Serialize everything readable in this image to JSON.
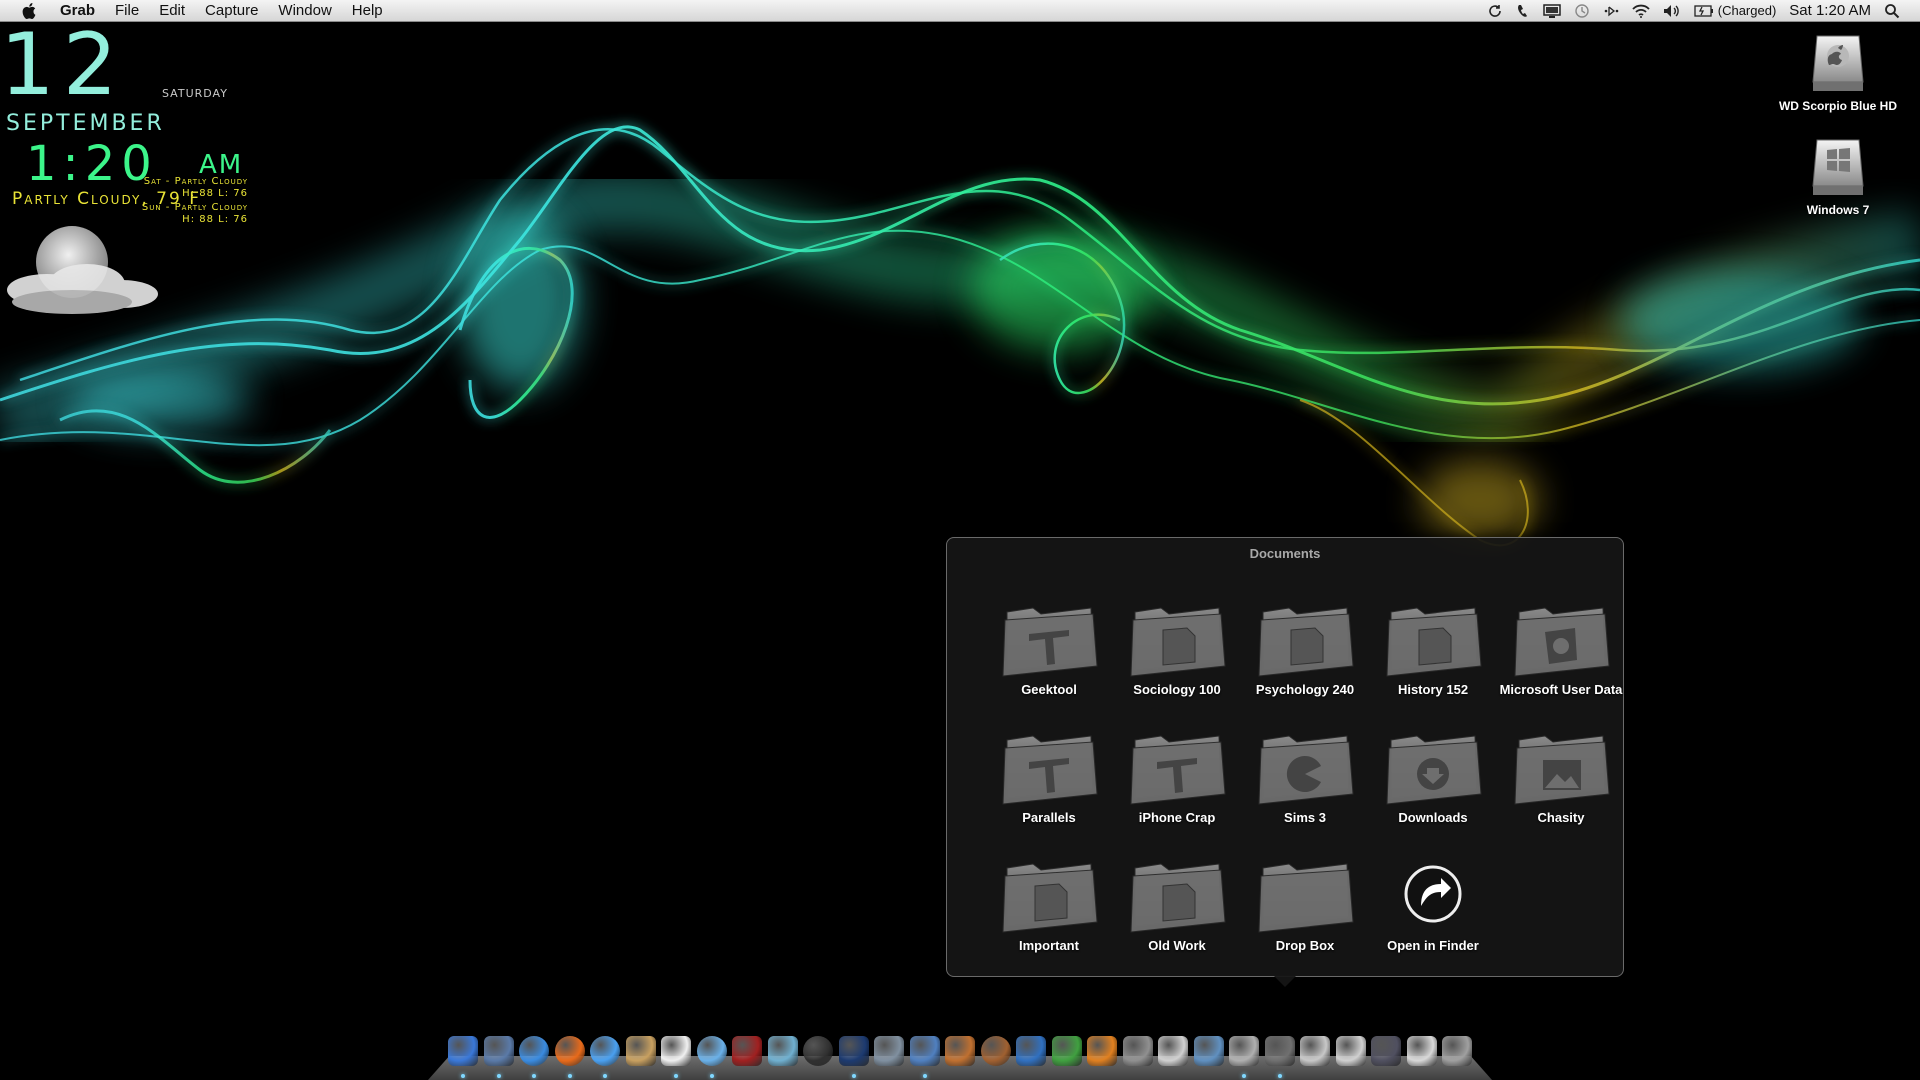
{
  "menubar": {
    "app_name": "Grab",
    "menus": [
      "File",
      "Edit",
      "Capture",
      "Window",
      "Help"
    ],
    "status_items": [
      "sync-icon",
      "phone-icon",
      "display-icon",
      "time-machine-icon",
      "bluetooth-icon",
      "wifi-icon",
      "volume-icon",
      "battery-icon",
      "spotlight-icon"
    ],
    "battery_text": "(Charged)",
    "clock": "Sat 1:20 AM"
  },
  "clock_widget": {
    "day": "12",
    "weekday": "Saturday",
    "month": "September",
    "time": "1:20",
    "ampm": "AM",
    "weather_now": "Partly Cloudy, 79 F",
    "forecast": [
      {
        "line1": "Sat - Partly Cloudy",
        "line2": "H: 88 L: 76"
      },
      {
        "line1": "Sun - Partly Cloudy",
        "line2": "H: 88 L: 76"
      }
    ]
  },
  "desktop": {
    "drives": [
      {
        "label": "WD Scorpio Blue HD",
        "icon": "hard-drive-apple-icon"
      },
      {
        "label": "Windows 7",
        "icon": "hard-drive-windows-icon"
      }
    ]
  },
  "stack": {
    "title": "Documents",
    "items": [
      {
        "label": "Geektool",
        "icon": "folder-hammer-icon"
      },
      {
        "label": "Sociology 100",
        "icon": "folder-doc-icon"
      },
      {
        "label": "Psychology 240",
        "icon": "folder-doc-icon"
      },
      {
        "label": "History 152",
        "icon": "folder-doc-icon"
      },
      {
        "label": "Microsoft User Data",
        "icon": "folder-office-icon"
      },
      {
        "label": "Parallels",
        "icon": "folder-hammer-icon"
      },
      {
        "label": "iPhone Crap",
        "icon": "folder-hammer-icon"
      },
      {
        "label": "Sims 3",
        "icon": "folder-pacman-icon"
      },
      {
        "label": "Downloads",
        "icon": "folder-download-icon"
      },
      {
        "label": "Chasity",
        "icon": "folder-picture-icon"
      },
      {
        "label": "Important",
        "icon": "folder-doc-icon"
      },
      {
        "label": "Old Work",
        "icon": "folder-doc-icon"
      },
      {
        "label": "Drop Box",
        "icon": "folder-plain-icon"
      },
      {
        "label": "Open in Finder",
        "icon": "open-in-finder-icon"
      }
    ]
  },
  "dock": {
    "items": [
      {
        "icon": "finder-icon",
        "color": "#3a78d8"
      },
      {
        "icon": "mail-icon",
        "color": "#5a7aa8"
      },
      {
        "icon": "safari-icon",
        "color": "#3a8be0"
      },
      {
        "icon": "firefox-icon",
        "color": "#e86a1a"
      },
      {
        "icon": "ichat-icon",
        "color": "#4aa0f0"
      },
      {
        "icon": "address-book-icon",
        "color": "#c8a060"
      },
      {
        "icon": "ical-icon",
        "color": "#f0f0f0"
      },
      {
        "icon": "itunes-icon",
        "color": "#6ab0e8"
      },
      {
        "icon": "photo-booth-icon",
        "color": "#a02020"
      },
      {
        "icon": "network-utility-icon",
        "color": "#70b0d0"
      },
      {
        "icon": "aperture-icon",
        "color": "#303030"
      },
      {
        "icon": "photoshop-icon",
        "color": "#1c3a70"
      },
      {
        "icon": "script-editor-icon",
        "color": "#8090a0"
      },
      {
        "icon": "charts-icon",
        "color": "#5080c0"
      },
      {
        "icon": "widget-icon",
        "color": "#c07030"
      },
      {
        "icon": "coffee-icon",
        "color": "#a06030"
      },
      {
        "icon": "word-icon",
        "color": "#3070c0"
      },
      {
        "icon": "excel-icon",
        "color": "#40a040"
      },
      {
        "icon": "powerpoint-icon",
        "color": "#e08020"
      },
      {
        "icon": "system-preferences-icon",
        "color": "#909090"
      },
      {
        "icon": "preview-icon",
        "color": "#d0d0d0"
      },
      {
        "icon": "iphoto-icon",
        "color": "#6090c0"
      },
      {
        "icon": "grab-icon",
        "color": "#b0b0b0"
      },
      {
        "icon": "documents-stack-icon",
        "color": "#707070"
      },
      {
        "icon": "stack-file-icon",
        "color": "#c8c8c8"
      },
      {
        "icon": "stack-file-icon",
        "color": "#d0d0d0"
      },
      {
        "icon": "stack-photo-icon",
        "color": "#505060"
      },
      {
        "icon": "stack-file-icon",
        "color": "#d8d8d8"
      },
      {
        "icon": "trash-icon",
        "color": "#a0a0a0"
      }
    ]
  }
}
